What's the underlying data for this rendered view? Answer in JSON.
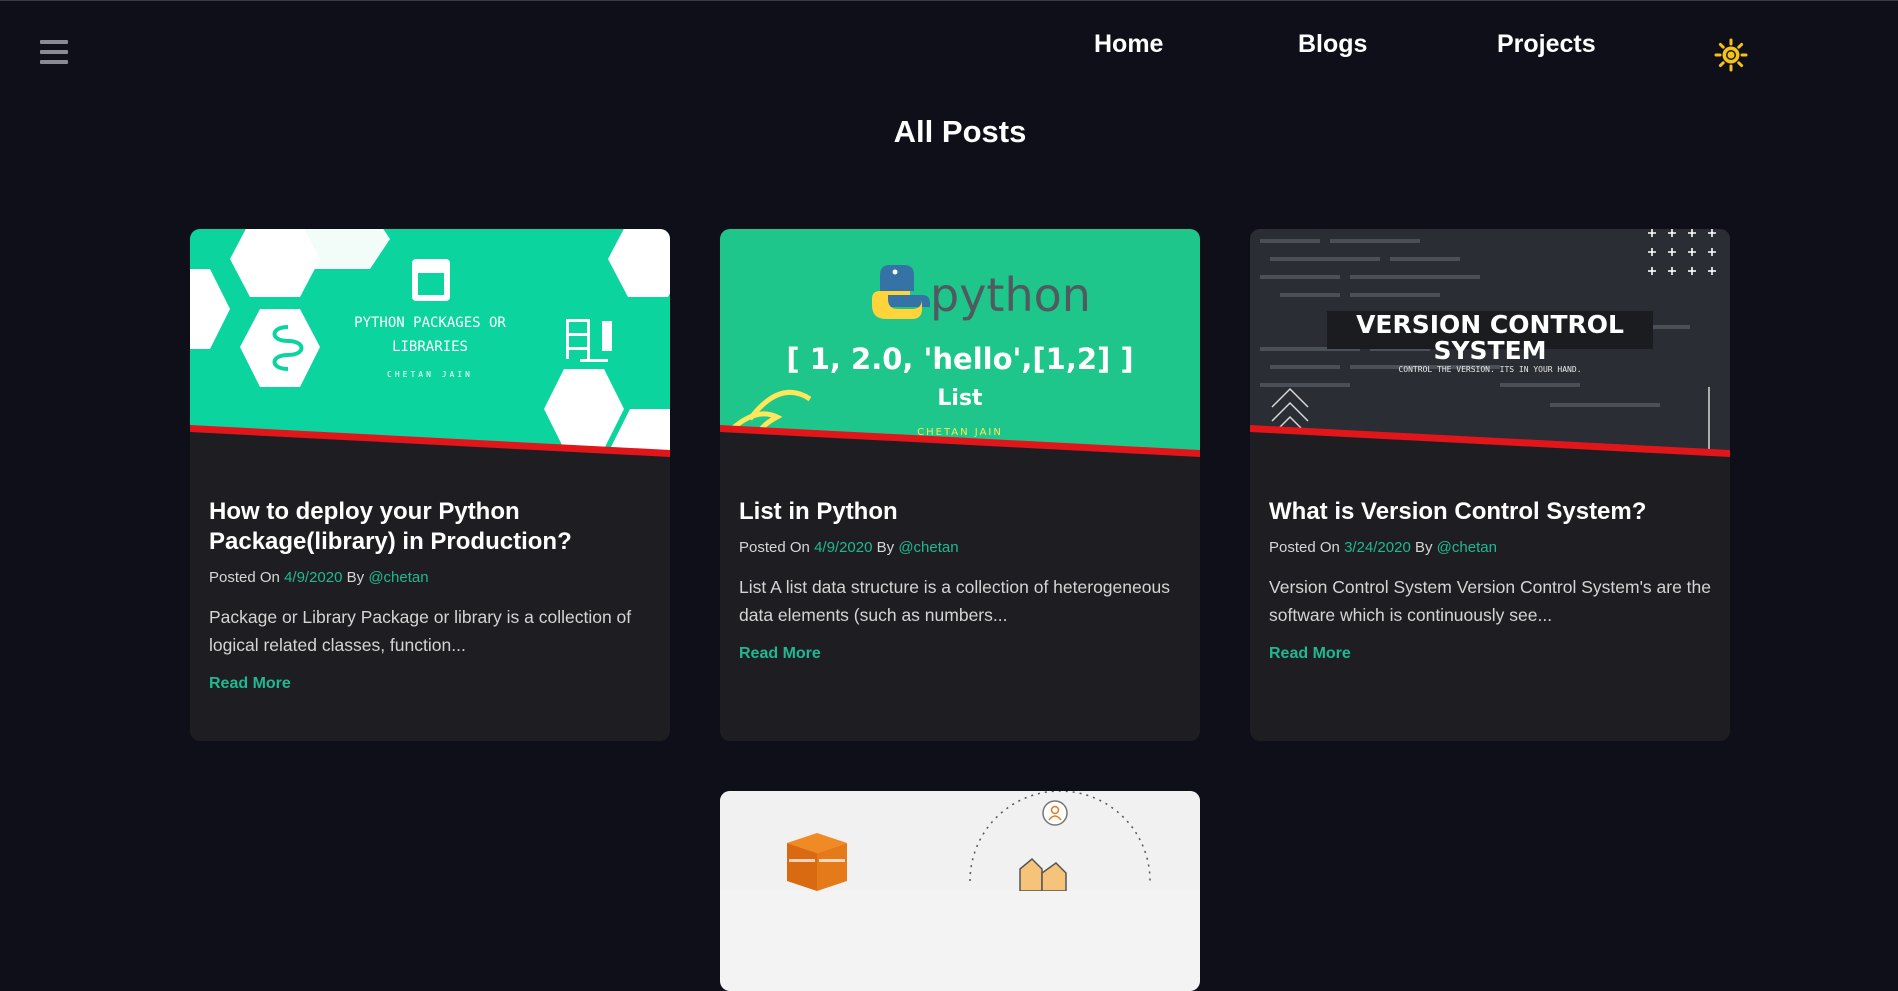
{
  "nav": {
    "home": "Home",
    "blogs": "Blogs",
    "projects": "Projects"
  },
  "page": {
    "title": "All Posts"
  },
  "posts": [
    {
      "title": "How to deploy your Python Package(library) in Production?",
      "posted_on_label": "Posted On",
      "date": "4/9/2020",
      "by_label": "By",
      "author": "@chetan",
      "excerpt": "Package or Library Package or library is a collection of logical related classes, function...",
      "read_more": "Read More",
      "thumb": {
        "line1": "PYTHON PACKAGES OR",
        "line2": "LIBRARIES",
        "author": "CHETAN JAIN",
        "bg": "#0bd49f"
      }
    },
    {
      "title": "List in Python",
      "posted_on_label": "Posted On",
      "date": "4/9/2020",
      "by_label": "By",
      "author": "@chetan",
      "excerpt": "List A list data structure is a collection of heterogeneous data elements (such as numbers...",
      "read_more": "Read More",
      "thumb": {
        "logo": "python",
        "code": "[ 1, 2.0, 'hello',[1,2] ]",
        "label": "List",
        "author": "CHETAN JAIN",
        "bg": "#1ec68b"
      }
    },
    {
      "title": "What is Version Control System?",
      "posted_on_label": "Posted On",
      "date": "3/24/2020",
      "by_label": "By",
      "author": "@chetan",
      "excerpt": "Version Control System Version Control System's are the software which is continuously see...",
      "read_more": "Read More",
      "thumb": {
        "line1": "VERSION CONTROL",
        "line2": "SYSTEM",
        "tagline": "CONTROL THE VERSION. ITS IN YOUR HAND.",
        "bg": "#2a2d33"
      }
    }
  ],
  "colors": {
    "accent": "#1fb892",
    "background": "#0f0f1a",
    "card": "#1e1e22",
    "stripe": "#e0161b",
    "sun": "#f4c21a"
  },
  "icons": {
    "menu": "hamburger-menu-icon",
    "theme": "sun-icon"
  }
}
